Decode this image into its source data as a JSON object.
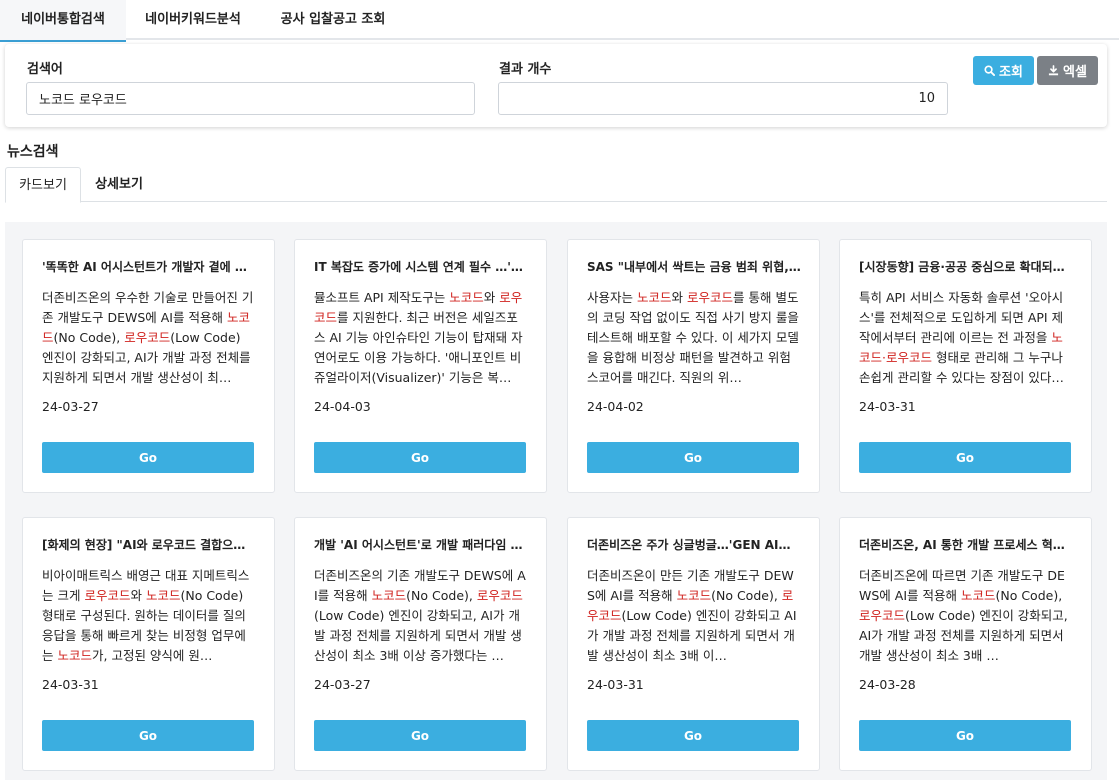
{
  "top_tabs": [
    "네이버통합검색",
    "네이버키워드분석",
    "공사 입찰공고 조회"
  ],
  "search": {
    "keyword_label": "검색어",
    "keyword_value": "노코드 로우코드",
    "count_label": "결과 개수",
    "count_value": "10",
    "search_button": "조회",
    "excel_button": "엑셀",
    "search_icon": "search-icon",
    "excel_icon": "download-icon"
  },
  "section_title": "뉴스검색",
  "view_tabs": [
    "카드보기",
    "상세보기"
  ],
  "colors": {
    "accent": "#3baee0",
    "highlight": "#d0231f",
    "excel": "#7b8086"
  },
  "cards": [
    {
      "title": "'똑똑한 AI 어시스턴트가 개발자 곁에 …",
      "body": [
        {
          "t": "더존비즈온의 우수한 기술로 만들어진 기존 개발도구 DEWS에 AI를 적용해 "
        },
        {
          "t": "노코드",
          "h": true
        },
        {
          "t": "(No Code), "
        },
        {
          "t": "로우코드",
          "h": true
        },
        {
          "t": "(Low Code) 엔진이 강화되고, AI가 개발 과정 전체를 지원하게 되면서 개발 생산성이 최…"
        }
      ],
      "date": "24-03-27",
      "button": "Go"
    },
    {
      "title": "IT 복잡도 증가에 시스템 연계 필수 …'…",
      "body": [
        {
          "t": "뮬소프트 API 제작도구는 "
        },
        {
          "t": "노코드",
          "h": true
        },
        {
          "t": "와 "
        },
        {
          "t": "로우코드",
          "h": true
        },
        {
          "t": "를 지원한다. 최근 버전은 세일즈포스 AI 기능 아인슈타인 기능이 탑재돼 자연어로도 이용 가능하다. '애니포인트 비쥬얼라이저(Visualizer)' 기능은 복…"
        }
      ],
      "date": "24-04-03",
      "button": "Go"
    },
    {
      "title": "SAS \"내부에서 싹트는 금융 범죄 위협,…",
      "body": [
        {
          "t": "사용자는 "
        },
        {
          "t": "노코드",
          "h": true
        },
        {
          "t": "와 "
        },
        {
          "t": "로우코드",
          "h": true
        },
        {
          "t": "를 통해 별도의 코딩 작업 없이도 직접 사기 방지 룰을 테스트해 배포할 수 있다. 이 세가지 모델을 융합해 비정상 패턴을 발견하고 위험 스코어를 매긴다. 직원의 위…"
        }
      ],
      "date": "24-04-02",
      "button": "Go"
    },
    {
      "title": "[시장동향] 금융·공공 중심으로 확대되…",
      "body": [
        {
          "t": "특히 API 서비스 자동화 솔루션 '오아시스'를 전체적으로 도입하게 되면 API 제작에서부터 관리에 이르는 전 과정을 "
        },
        {
          "t": "노코드·로우코드",
          "h": true
        },
        {
          "t": " 형태로 관리해 그 누구나 손쉽게 관리할 수 있다는 장점이 있다…"
        }
      ],
      "date": "24-03-31",
      "button": "Go"
    },
    {
      "title_parts": [
        {
          "t": "[화제의 현장] \"AI와 "
        },
        {
          "t": "로우코드",
          "h": true
        },
        {
          "t": " 결합으로…"
        }
      ],
      "body": [
        {
          "t": "비아이매트릭스 배영근 대표 지메트릭스는 크게 "
        },
        {
          "t": "로우코드",
          "h": true
        },
        {
          "t": "와 "
        },
        {
          "t": "노코드",
          "h": true
        },
        {
          "t": "(No Code) 형태로 구성된다. 원하는 데이터를 질의응답을 통해 빠르게 찾는 비정형 업무에는 "
        },
        {
          "t": "노코드",
          "h": true
        },
        {
          "t": "가, 고정된 양식에 원…"
        }
      ],
      "date": "24-03-31",
      "button": "Go"
    },
    {
      "title": "개발 'AI 어시스턴트'로 개발 패러다임 …",
      "body": [
        {
          "t": "더존비즈온의 기존 개발도구 DEWS에 AI를 적용해 "
        },
        {
          "t": "노코드",
          "h": true
        },
        {
          "t": "(No Code), "
        },
        {
          "t": "로우코드",
          "h": true
        },
        {
          "t": "(Low Code) 엔진이 강화되고, AI가 개발 과정 전체를 지원하게 되면서 개발 생산성이 최소 3배 이상 증가했다는 …"
        }
      ],
      "date": "24-03-27",
      "button": "Go"
    },
    {
      "title": "더존비즈온 주가 싱글벙글…'GEN AI…",
      "body": [
        {
          "t": "더존비즈온이 만든 기존 개발도구 DEWS에 AI를 적용해 "
        },
        {
          "t": "노코드",
          "h": true
        },
        {
          "t": "(No Code), "
        },
        {
          "t": "로우코드",
          "h": true
        },
        {
          "t": "(Low Code) 엔진이 강화되고 AI가 개발 과정 전체를 지원하게 되면서 개발 생산성이 최소 3배 이…"
        }
      ],
      "date": "24-03-31",
      "button": "Go"
    },
    {
      "title": "더존비즈온, AI 통한 개발 프로세스 혁…",
      "body": [
        {
          "t": "더존비즈온에 따르면 기존 개발도구 DEWS에 AI를 적용해 "
        },
        {
          "t": "노코드",
          "h": true
        },
        {
          "t": "(No Code), "
        },
        {
          "t": "로우코드",
          "h": true
        },
        {
          "t": "(Low Code) 엔진이 강화되고, AI가 개발 과정 전체를 지원하게 되면서 개발 생산성이 최소 3배 …"
        }
      ],
      "date": "24-03-28",
      "button": "Go"
    }
  ]
}
